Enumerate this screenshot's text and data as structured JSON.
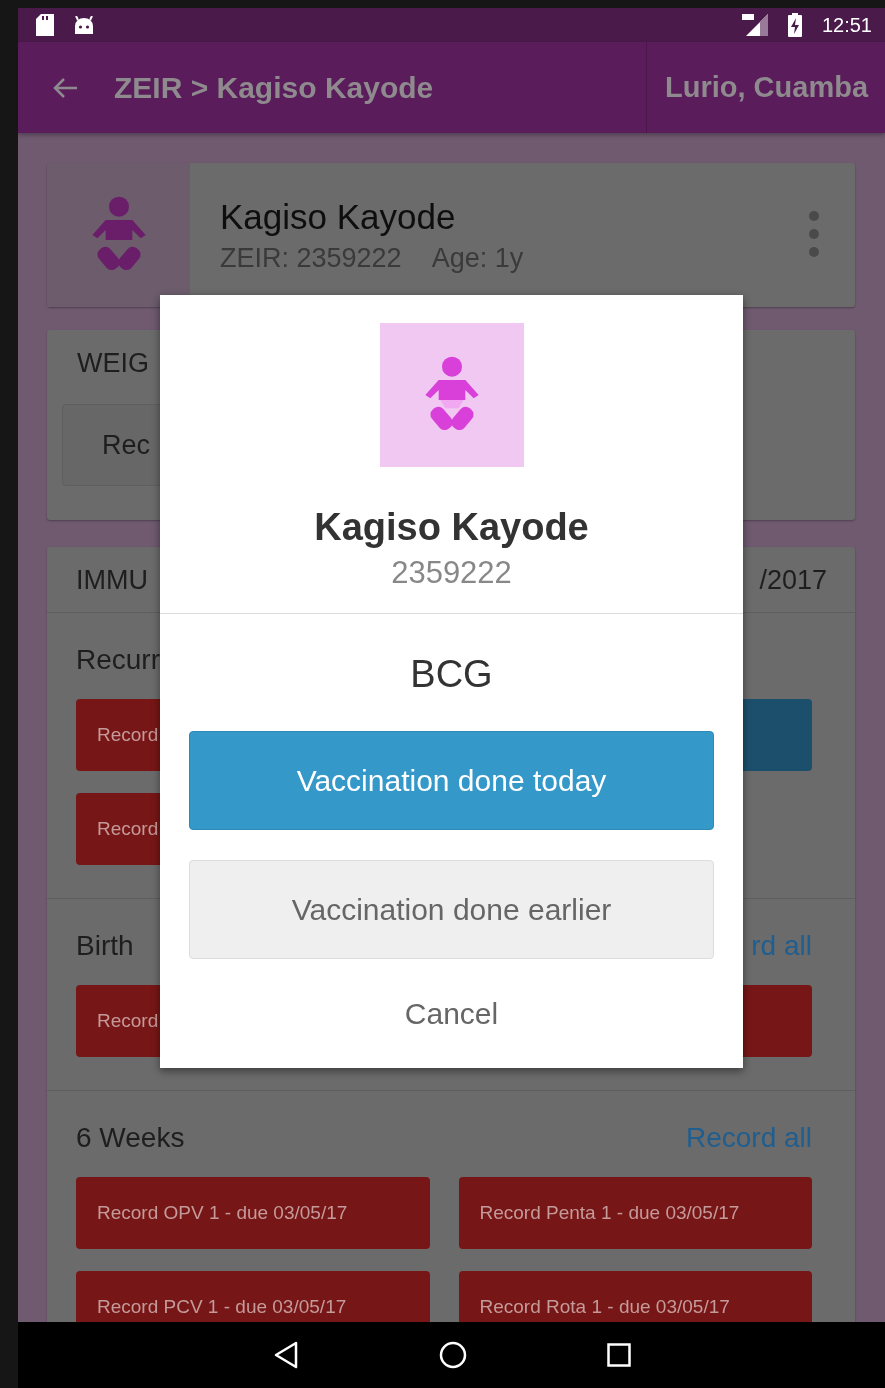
{
  "status_bar": {
    "time": "12:51"
  },
  "app_bar": {
    "title": "ZEIR > Kagiso Kayode",
    "location": "Lurio, Cuamba"
  },
  "profile": {
    "name": "Kagiso Kayode",
    "id_label": "ZEIR: 2359222",
    "age_label": "Age: 1y"
  },
  "weight_card": {
    "title": "WEIG",
    "button": "Rec"
  },
  "immunization_card": {
    "title": "IMMU",
    "date": "/2017",
    "sections": [
      {
        "title": "Recurr",
        "buttons": [
          {
            "label": "Record",
            "color": "#771616"
          },
          {
            "color": "#1c4f6c"
          },
          {
            "label": "Record",
            "color": "#771616"
          }
        ]
      },
      {
        "title": "Birth",
        "action": "rd all",
        "buttons": [
          {
            "label": "Record",
            "color": "#771616"
          },
          {
            "color": "#771616"
          }
        ]
      },
      {
        "title": "6 Weeks",
        "action": "Record all",
        "buttons": [
          {
            "label": "Record OPV 1 - due 03/05/17",
            "color": "#771616"
          },
          {
            "label": "Record Penta 1 - due 03/05/17",
            "color": "#771616"
          },
          {
            "label": "Record PCV 1 - due 03/05/17",
            "color": "#771616"
          },
          {
            "label": "Record Rota 1 - due 03/05/17",
            "color": "#771616"
          }
        ]
      }
    ]
  },
  "dialog": {
    "name": "Kagiso Kayode",
    "id": "2359222",
    "vaccine": "BCG",
    "buttons": [
      {
        "label": "Vaccination done today",
        "kind": "primary"
      },
      {
        "label": "Vaccination done earlier",
        "kind": "secondary"
      },
      {
        "label": "Cancel",
        "kind": "text"
      }
    ]
  }
}
